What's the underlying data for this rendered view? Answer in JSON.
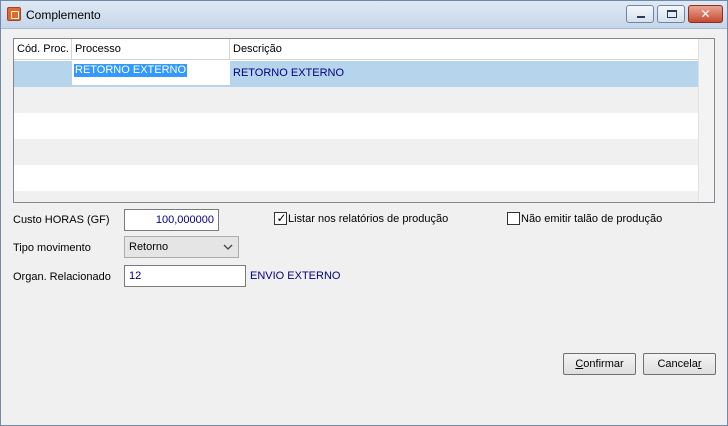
{
  "window": {
    "title": "Complemento"
  },
  "grid": {
    "columns": [
      "Cód. Proc.",
      "Processo",
      "Descrição"
    ],
    "rows": [
      {
        "codigo": "",
        "processo": "RETORNO EXTERNO",
        "descricao": "RETORNO EXTERNO"
      }
    ]
  },
  "form": {
    "custo_label": "Custo HORAS (GF)",
    "custo_value": "100,000000",
    "listar_label": "Listar nos relatórios de produção",
    "listar_checked": true,
    "nao_emitir_label": "Não emitir talão de produção",
    "nao_emitir_checked": false,
    "tipo_label": "Tipo movimento",
    "tipo_value": "Retorno",
    "organ_label": "Organ. Relacionado",
    "organ_value": "12",
    "organ_desc": "ENVIO EXTERNO"
  },
  "buttons": {
    "confirmar_first": "C",
    "confirmar_rest": "onfirmar",
    "cancelar_first": "Cancela",
    "cancelar_u": "r"
  },
  "colors": {
    "selection_row": "#b7d4ed",
    "edit_highlight": "#3399ff",
    "value_text": "#000080"
  }
}
